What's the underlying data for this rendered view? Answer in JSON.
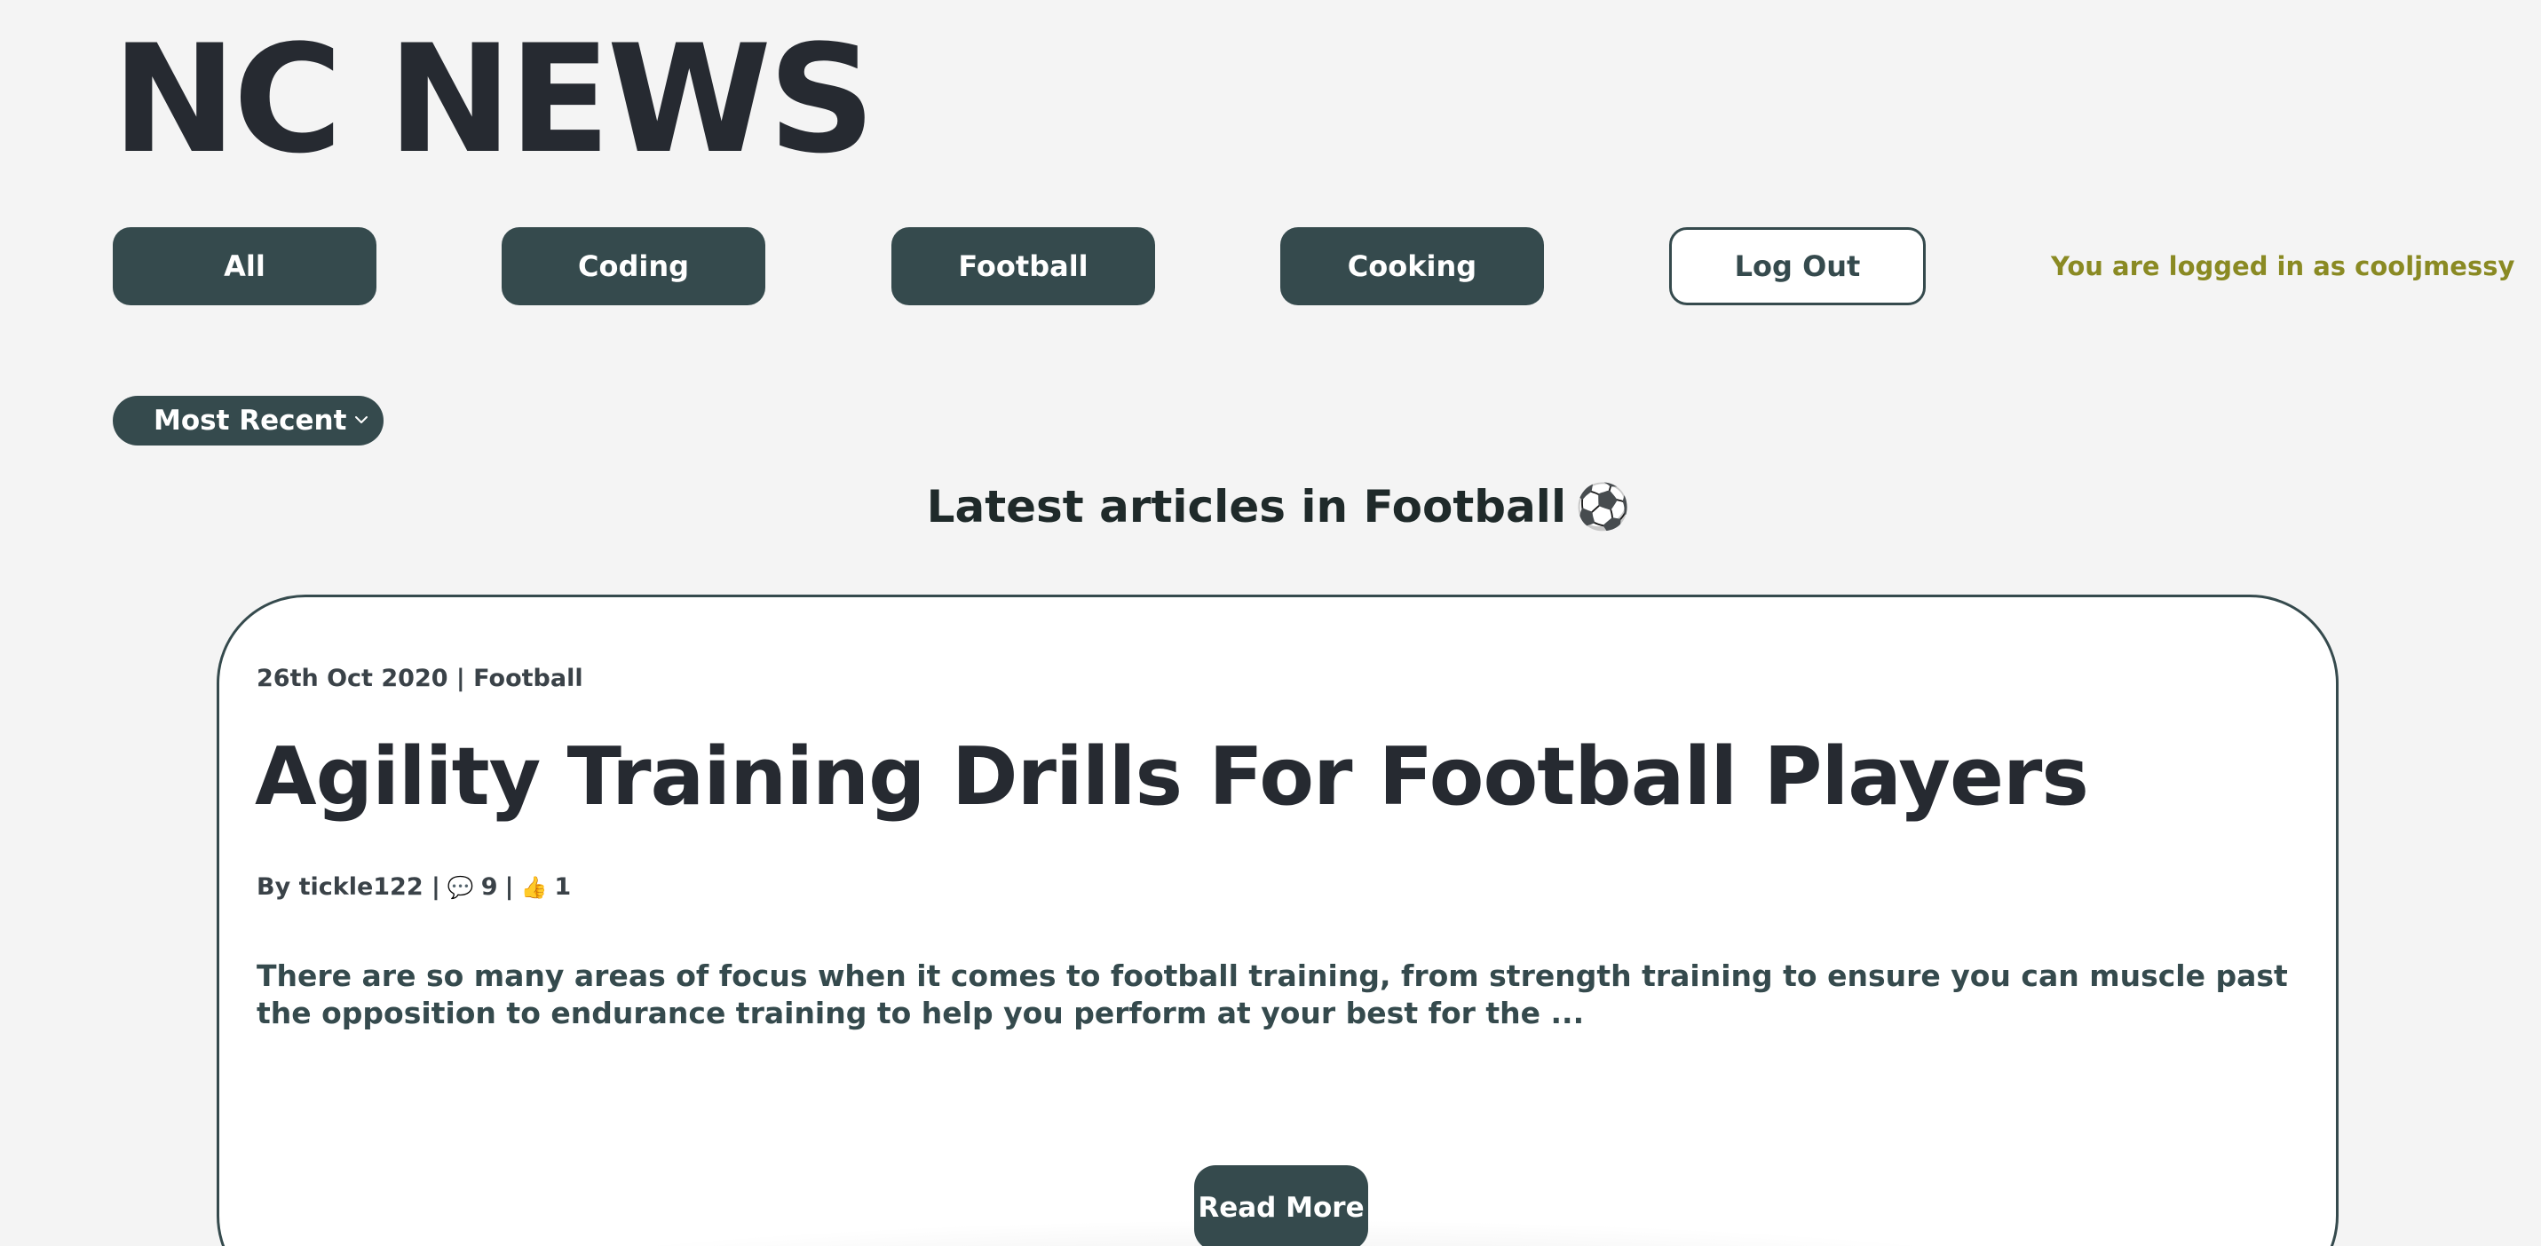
{
  "site": {
    "title": "NC NEWS"
  },
  "nav": {
    "items": [
      {
        "label": "All"
      },
      {
        "label": "Coding"
      },
      {
        "label": "Football"
      },
      {
        "label": "Cooking"
      }
    ],
    "logout_label": "Log Out",
    "login_status": "You are logged in as cooljmessy"
  },
  "sort": {
    "selected": "Most Recent"
  },
  "section": {
    "heading": "Latest articles in Football",
    "emoji": "⚽"
  },
  "article": {
    "meta": "26th Oct 2020 | Football",
    "title": "Agility Training Drills For Football Players",
    "author_text": "By tickle122 |",
    "comment_icon": "💬",
    "comment_count": "9",
    "separator": "|",
    "vote_icon": "👍",
    "vote_count": "1",
    "excerpt": "There are so many areas of focus when it comes to football training, from strength training to ensure you can muscle past the opposition to endurance training to help you perform at your best for the ...",
    "read_more_label": "Read More"
  },
  "colors": {
    "primary": "#354a4d",
    "background": "#f4f4f4",
    "status_text": "#8a8a23",
    "title_text": "#262a31"
  }
}
